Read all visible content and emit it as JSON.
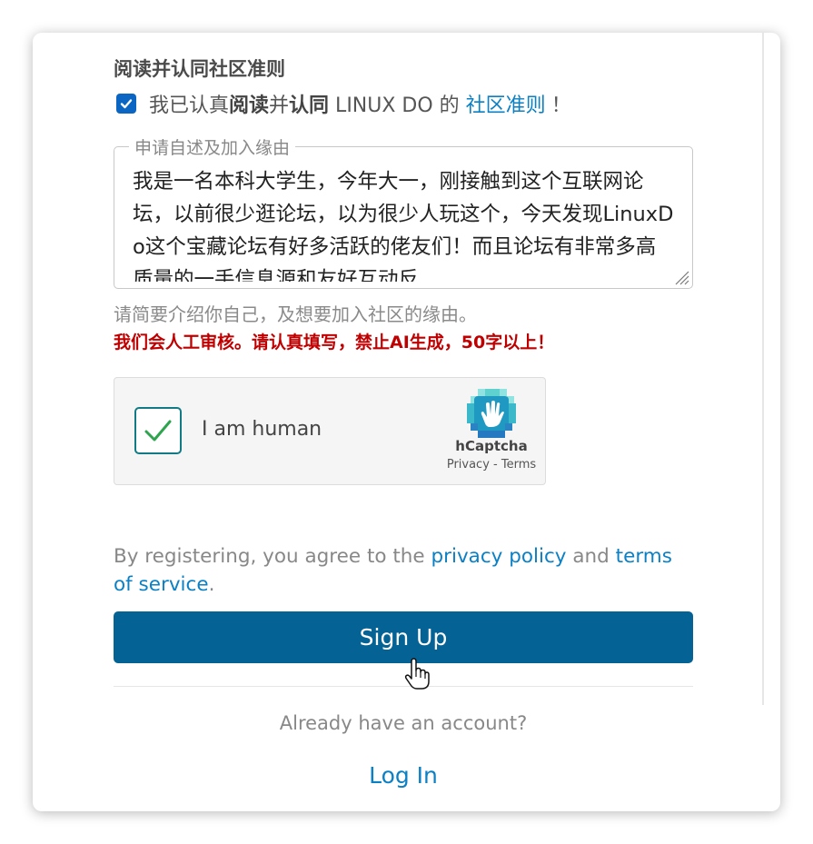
{
  "guidelines": {
    "title": "阅读并认同社区准则",
    "checked": true,
    "agree_prefix": "我已认真",
    "agree_bold1": "阅读",
    "agree_mid": "并",
    "agree_bold2": "认同",
    "agree_site": " LINUX DO 的 ",
    "agree_link": "社区准则",
    "agree_suffix": "！"
  },
  "application": {
    "legend": "申请自述及加入缘由",
    "text": "我是一名本科大学生，今年大一，刚接触到这个互联网论坛，以前很少逛论坛，以为很少人玩这个，今天发现LinuxDo这个宝藏论坛有好多活跃的佬友们！而且论坛有非常多高质量的一手信息源和友好互动反",
    "hint": "请简要介绍你自己，及想要加入社区的缘由。",
    "warning": "我们会人工审核。请认真填写，禁止AI生成，50字以上！"
  },
  "captcha": {
    "label": "I am human",
    "brand": "hCaptcha",
    "privacy": "Privacy",
    "separator": " - ",
    "terms": "Terms",
    "checked": true
  },
  "terms": {
    "prefix": "By registering, you agree to the ",
    "privacy_link": "privacy policy",
    "and": " and ",
    "tos_link": "terms of service",
    "suffix": "."
  },
  "actions": {
    "signup_label": "Sign Up",
    "have_account": "Already have an account?",
    "login_label": "Log In"
  },
  "colors": {
    "primary_button": "#046295",
    "link": "#0b80c5",
    "warning": "#c00000",
    "checkbox": "#0a66c2"
  }
}
